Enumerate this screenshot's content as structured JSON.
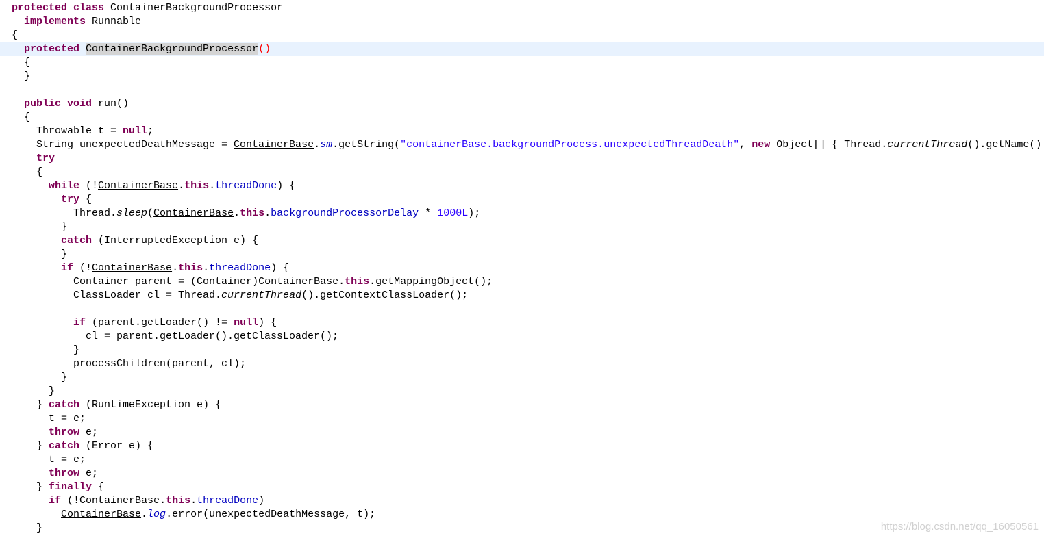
{
  "colors": {
    "keyword": "#7f0055",
    "string": "#2a00ff",
    "field": "#0000c0",
    "bracket_match": "#ff0000",
    "current_line_bg": "#e8f2fe",
    "occurrence_bg": "#d4d4d4"
  },
  "editor": {
    "current_line": 3,
    "lines": [
      {
        "indent": 0,
        "tokens": [
          {
            "t": "protected",
            "s": "kw"
          },
          {
            "t": " "
          },
          {
            "t": "class",
            "s": "kw"
          },
          {
            "t": " ContainerBackgroundProcessor"
          }
        ]
      },
      {
        "indent": 1,
        "tokens": [
          {
            "t": "implements",
            "s": "kw"
          },
          {
            "t": " Runnable"
          }
        ]
      },
      {
        "indent": 0,
        "tokens": [
          {
            "t": "{"
          }
        ]
      },
      {
        "indent": 1,
        "tokens": [
          {
            "t": "protected",
            "s": "kw"
          },
          {
            "t": " "
          },
          {
            "t": "ContainerBackgroundProcessor",
            "s": "occ"
          },
          {
            "t": "()",
            "s": "brk"
          }
        ]
      },
      {
        "indent": 1,
        "tokens": [
          {
            "t": "{"
          }
        ]
      },
      {
        "indent": 1,
        "tokens": [
          {
            "t": "}"
          }
        ]
      },
      {
        "indent": 0,
        "tokens": []
      },
      {
        "indent": 1,
        "tokens": [
          {
            "t": "public",
            "s": "kw"
          },
          {
            "t": " "
          },
          {
            "t": "void",
            "s": "kw"
          },
          {
            "t": " run()"
          }
        ]
      },
      {
        "indent": 1,
        "tokens": [
          {
            "t": "{"
          }
        ]
      },
      {
        "indent": 2,
        "tokens": [
          {
            "t": "Throwable t = "
          },
          {
            "t": "null",
            "s": "kw"
          },
          {
            "t": ";"
          }
        ]
      },
      {
        "indent": 2,
        "tokens": [
          {
            "t": "String unexpectedDeathMessage = "
          },
          {
            "t": "ContainerBase",
            "s": "ul"
          },
          {
            "t": "."
          },
          {
            "t": "sm",
            "s": "fld ital"
          },
          {
            "t": ".getString("
          },
          {
            "t": "\"containerBase.backgroundProcess.unexpectedThreadDeath\"",
            "s": "str"
          },
          {
            "t": ", "
          },
          {
            "t": "new",
            "s": "kw"
          },
          {
            "t": " Object[] { Thread."
          },
          {
            "t": "currentThread",
            "s": "ital"
          },
          {
            "t": "().getName() });"
          }
        ]
      },
      {
        "indent": 2,
        "tokens": [
          {
            "t": "try",
            "s": "kw"
          }
        ]
      },
      {
        "indent": 2,
        "tokens": [
          {
            "t": "{"
          }
        ]
      },
      {
        "indent": 3,
        "tokens": [
          {
            "t": "while",
            "s": "kw"
          },
          {
            "t": " (!"
          },
          {
            "t": "ContainerBase",
            "s": "ul"
          },
          {
            "t": "."
          },
          {
            "t": "this",
            "s": "kw"
          },
          {
            "t": "."
          },
          {
            "t": "threadDone",
            "s": "fld"
          },
          {
            "t": ") {"
          }
        ]
      },
      {
        "indent": 4,
        "tokens": [
          {
            "t": "try",
            "s": "kw"
          },
          {
            "t": " {"
          }
        ]
      },
      {
        "indent": 5,
        "tokens": [
          {
            "t": "Thread."
          },
          {
            "t": "sleep",
            "s": "ital"
          },
          {
            "t": "("
          },
          {
            "t": "ContainerBase",
            "s": "ul"
          },
          {
            "t": "."
          },
          {
            "t": "this",
            "s": "kw"
          },
          {
            "t": "."
          },
          {
            "t": "backgroundProcessorDelay",
            "s": "fld"
          },
          {
            "t": " * "
          },
          {
            "t": "1000L",
            "s": "num"
          },
          {
            "t": ");"
          }
        ]
      },
      {
        "indent": 4,
        "tokens": [
          {
            "t": "}"
          }
        ]
      },
      {
        "indent": 4,
        "tokens": [
          {
            "t": "catch",
            "s": "kw"
          },
          {
            "t": " (InterruptedException e) {"
          }
        ]
      },
      {
        "indent": 4,
        "tokens": [
          {
            "t": "}"
          }
        ]
      },
      {
        "indent": 4,
        "tokens": [
          {
            "t": "if",
            "s": "kw"
          },
          {
            "t": " (!"
          },
          {
            "t": "ContainerBase",
            "s": "ul"
          },
          {
            "t": "."
          },
          {
            "t": "this",
            "s": "kw"
          },
          {
            "t": "."
          },
          {
            "t": "threadDone",
            "s": "fld"
          },
          {
            "t": ") {"
          }
        ]
      },
      {
        "indent": 5,
        "tokens": [
          {
            "t": "Container",
            "s": "ul"
          },
          {
            "t": " parent = ("
          },
          {
            "t": "Container",
            "s": "ul"
          },
          {
            "t": ")"
          },
          {
            "t": "ContainerBase",
            "s": "ul"
          },
          {
            "t": "."
          },
          {
            "t": "this",
            "s": "kw"
          },
          {
            "t": ".getMappingObject();"
          }
        ]
      },
      {
        "indent": 5,
        "tokens": [
          {
            "t": "ClassLoader cl = Thread."
          },
          {
            "t": "currentThread",
            "s": "ital"
          },
          {
            "t": "().getContextClassLoader();"
          }
        ]
      },
      {
        "indent": 0,
        "tokens": []
      },
      {
        "indent": 5,
        "tokens": [
          {
            "t": "if",
            "s": "kw"
          },
          {
            "t": " (parent.getLoader() != "
          },
          {
            "t": "null",
            "s": "kw"
          },
          {
            "t": ") {"
          }
        ]
      },
      {
        "indent": 6,
        "tokens": [
          {
            "t": "cl = parent.getLoader().getClassLoader();"
          }
        ]
      },
      {
        "indent": 5,
        "tokens": [
          {
            "t": "}"
          }
        ]
      },
      {
        "indent": 5,
        "tokens": [
          {
            "t": "processChildren(parent, cl);"
          }
        ]
      },
      {
        "indent": 4,
        "tokens": [
          {
            "t": "}"
          }
        ]
      },
      {
        "indent": 3,
        "tokens": [
          {
            "t": "}"
          }
        ]
      },
      {
        "indent": 2,
        "tokens": [
          {
            "t": "} "
          },
          {
            "t": "catch",
            "s": "kw"
          },
          {
            "t": " (RuntimeException e) {"
          }
        ]
      },
      {
        "indent": 3,
        "tokens": [
          {
            "t": "t = e;"
          }
        ]
      },
      {
        "indent": 3,
        "tokens": [
          {
            "t": "throw",
            "s": "kw"
          },
          {
            "t": " e;"
          }
        ]
      },
      {
        "indent": 2,
        "tokens": [
          {
            "t": "} "
          },
          {
            "t": "catch",
            "s": "kw"
          },
          {
            "t": " (Error e) {"
          }
        ]
      },
      {
        "indent": 3,
        "tokens": [
          {
            "t": "t = e;"
          }
        ]
      },
      {
        "indent": 3,
        "tokens": [
          {
            "t": "throw",
            "s": "kw"
          },
          {
            "t": " e;"
          }
        ]
      },
      {
        "indent": 2,
        "tokens": [
          {
            "t": "} "
          },
          {
            "t": "finally",
            "s": "kw"
          },
          {
            "t": " {"
          }
        ]
      },
      {
        "indent": 3,
        "tokens": [
          {
            "t": "if",
            "s": "kw"
          },
          {
            "t": " (!"
          },
          {
            "t": "ContainerBase",
            "s": "ul"
          },
          {
            "t": "."
          },
          {
            "t": "this",
            "s": "kw"
          },
          {
            "t": "."
          },
          {
            "t": "threadDone",
            "s": "fld"
          },
          {
            "t": ")"
          }
        ]
      },
      {
        "indent": 4,
        "tokens": [
          {
            "t": "ContainerBase",
            "s": "ul"
          },
          {
            "t": "."
          },
          {
            "t": "log",
            "s": "fld ital"
          },
          {
            "t": ".error(unexpectedDeathMessage, t);"
          }
        ]
      },
      {
        "indent": 2,
        "tokens": [
          {
            "t": "}"
          }
        ]
      }
    ]
  },
  "watermark": "https://blog.csdn.net/qq_16050561"
}
